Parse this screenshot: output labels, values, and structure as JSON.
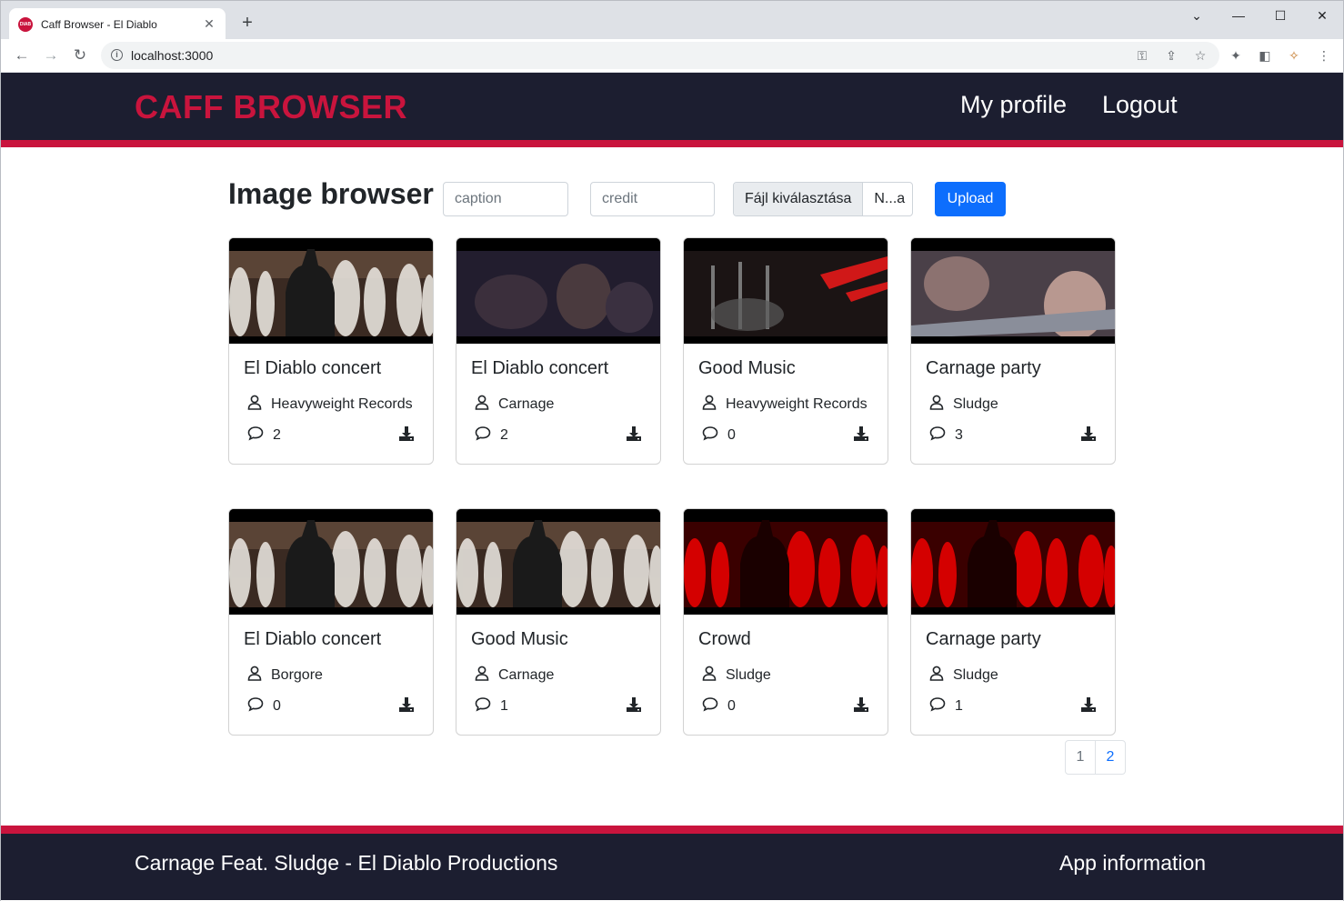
{
  "browser": {
    "tab_title": "Caff Browser - El Diablo",
    "favicon_text": "DIAB",
    "url": "localhost:3000"
  },
  "header": {
    "brand": "CAFF BROWSER",
    "nav": [
      "My profile",
      "Logout"
    ]
  },
  "main": {
    "title": "Image browser",
    "caption_placeholder": "caption",
    "credit_placeholder": "credit",
    "file_button": "Fájl kiválasztása",
    "file_name": "N...a",
    "upload_label": "Upload"
  },
  "cards": [
    {
      "title": "El Diablo concert",
      "credit": "Heavyweight Records",
      "comments": "2",
      "image": "concert-smoke"
    },
    {
      "title": "El Diablo concert",
      "credit": "Carnage",
      "comments": "2",
      "image": "crowd-dark"
    },
    {
      "title": "Good Music",
      "credit": "Heavyweight Records",
      "comments": "0",
      "image": "stage-lights"
    },
    {
      "title": "Carnage party",
      "credit": "Sludge",
      "comments": "3",
      "image": "crowd-faces"
    },
    {
      "title": "El Diablo concert",
      "credit": "Borgore",
      "comments": "0",
      "image": "concert-smoke"
    },
    {
      "title": "Good Music",
      "credit": "Carnage",
      "comments": "1",
      "image": "concert-smoke"
    },
    {
      "title": "Crowd",
      "credit": "Sludge",
      "comments": "0",
      "image": "concert-red"
    },
    {
      "title": "Carnage party",
      "credit": "Sludge",
      "comments": "1",
      "image": "concert-red"
    }
  ],
  "pagination": [
    "1",
    "2"
  ],
  "footer": {
    "left": "Carnage Feat. Sludge - El Diablo Productions",
    "right": "App information"
  },
  "colors": {
    "accent": "#c9143d",
    "navy": "#1c1e30",
    "primary": "#0d6efd"
  }
}
